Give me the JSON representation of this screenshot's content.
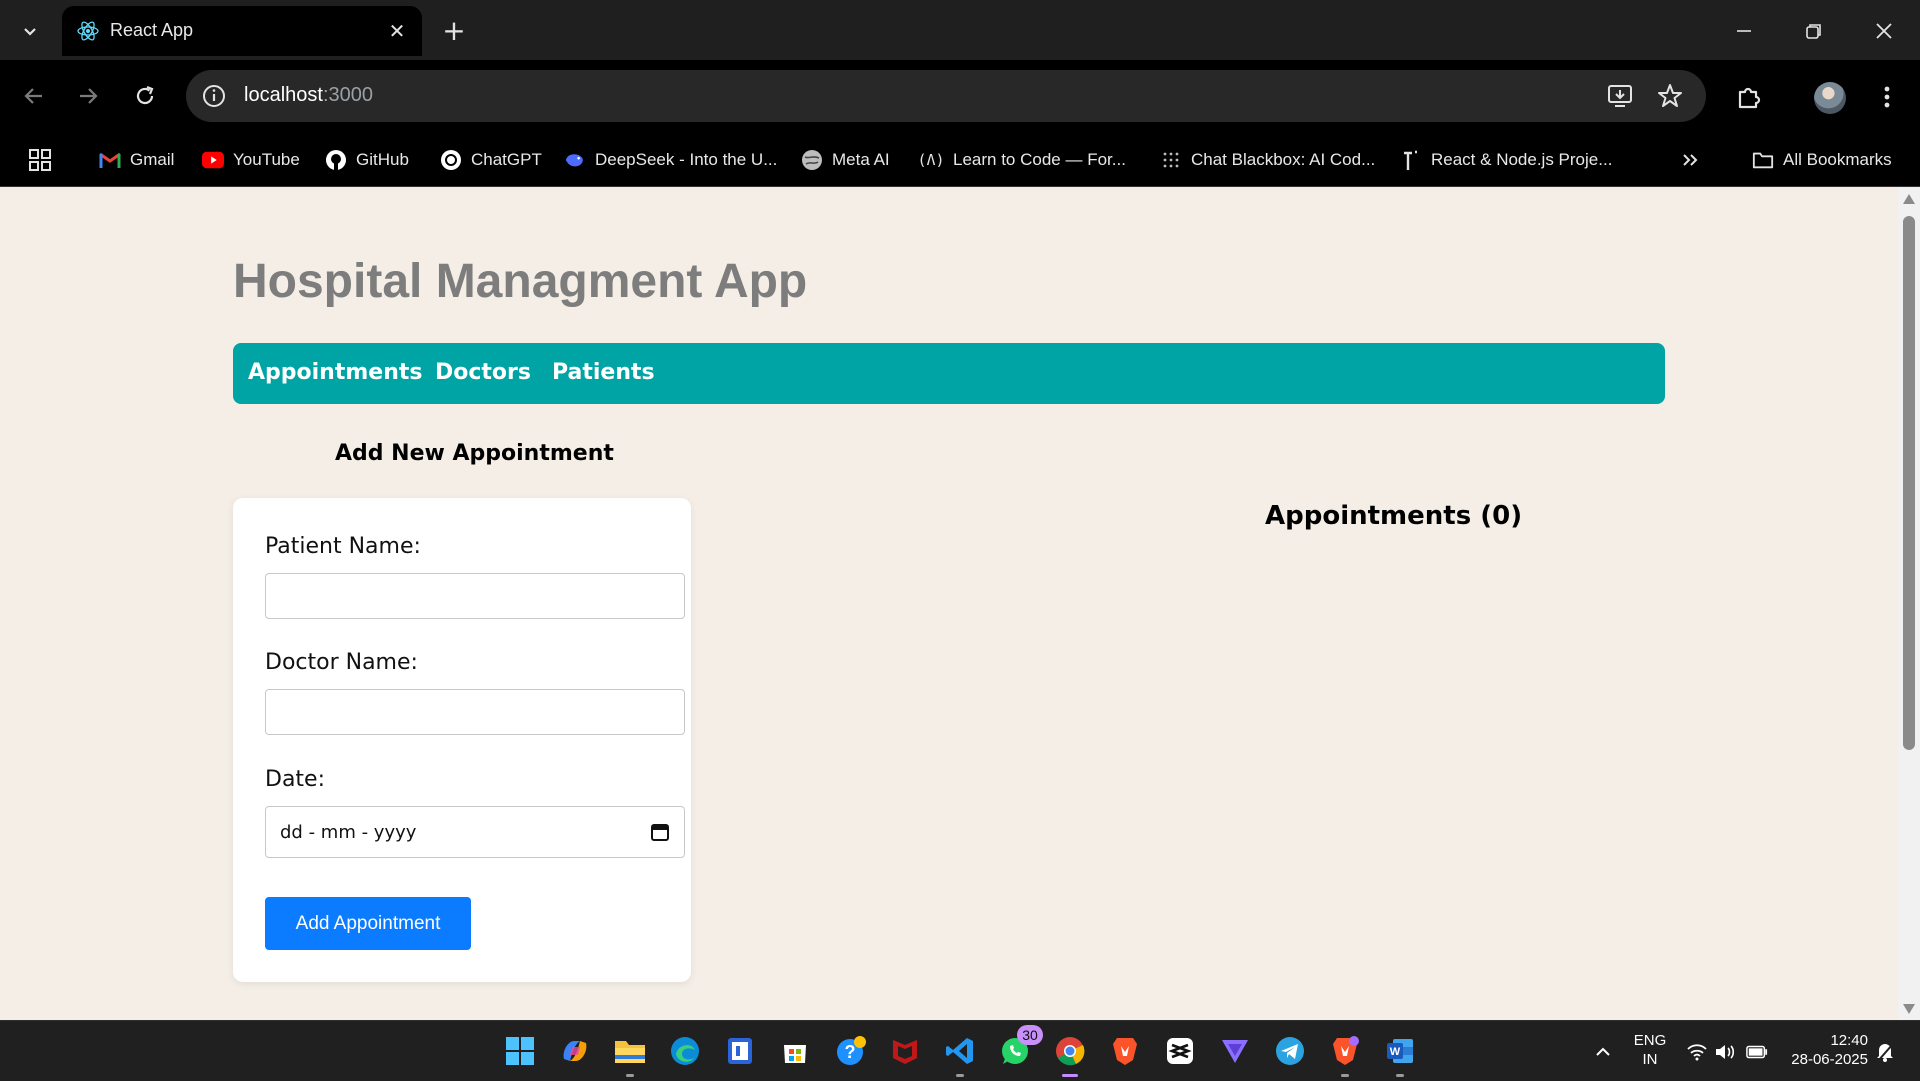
{
  "browser": {
    "tab_title": "React App",
    "url_host": "localhost",
    "url_port": ":3000",
    "bookmarks": [
      {
        "label": "Gmail",
        "icon": "gmail-icon"
      },
      {
        "label": "YouTube",
        "icon": "youtube-icon"
      },
      {
        "label": "GitHub",
        "icon": "github-icon"
      },
      {
        "label": "ChatGPT",
        "icon": "chatgpt-icon"
      },
      {
        "label": "DeepSeek - Into the U...",
        "icon": "deepseek-icon"
      },
      {
        "label": "Meta AI",
        "icon": "meta-ai-icon"
      },
      {
        "label": "Learn to Code — For...",
        "icon": "freecodecamp-icon"
      },
      {
        "label": "Chat Blackbox: AI Cod...",
        "icon": "blackbox-icon"
      },
      {
        "label": "React & Node.js Proje...",
        "icon": "bookmark-link-icon"
      }
    ],
    "all_bookmarks_label": "All Bookmarks"
  },
  "app": {
    "title": "Hospital Managment App",
    "nav": [
      "Appointments",
      "Doctors",
      "Patients"
    ],
    "form": {
      "heading": "Add New Appointment",
      "patient_label": "Patient Name:",
      "doctor_label": "Doctor Name:",
      "date_label": "Date:",
      "date_placeholder": "dd - mm - yyyy",
      "patient_value": "",
      "doctor_value": "",
      "submit_label": "Add Appointment"
    },
    "list": {
      "heading": "Appointments (0)"
    }
  },
  "taskbar": {
    "whatsapp_badge": "30",
    "lang_line1": "ENG",
    "lang_line2": "IN",
    "time": "12:40",
    "date": "28-06-2025"
  },
  "colors": {
    "page_background": "#f5eee7",
    "navbar": "#00a4a4",
    "button": "#0b7bff",
    "title": "#7d7d7d"
  }
}
